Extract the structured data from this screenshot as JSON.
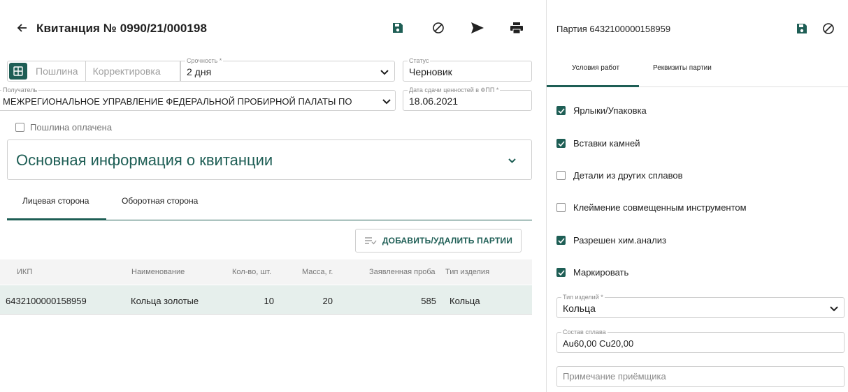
{
  "receipt": {
    "title": "Квитанция № 0990/21/000198",
    "segments": [
      "Пошлина",
      "Корректировка"
    ],
    "urgency": {
      "label": "Срочность *",
      "value": "2 дня"
    },
    "status": {
      "label": "Статус",
      "value": "Черновик"
    },
    "recipient": {
      "label": "Получатель",
      "value": "МЕЖРЕГИОНАЛЬНОЕ УПРАВЛЕНИЕ ФЕДЕРАЛЬНОЙ ПРОБИРНОЙ ПАЛАТЫ ПО"
    },
    "delivery_date": {
      "label": "Дата сдачи ценностей в ФПП *",
      "value": "18.06.2021"
    },
    "duty_paid": {
      "label": "Пошлина оплачена",
      "checked": false
    },
    "accordion_title": "Основная информация о квитанции",
    "tabs": [
      "Лицевая сторона",
      "Оборотная сторона"
    ],
    "add_button": "ДОБАВИТЬ/УДАЛИТЬ ПАРТИИ",
    "table": {
      "headers": [
        "ИКП",
        "Наименование",
        "Кол-во, шт.",
        "Масса, г.",
        "Заявленная проба",
        "Тип изделия"
      ],
      "rows": [
        [
          "6432100000158959",
          "Кольца золотые",
          "10",
          "20",
          "585",
          "Кольца"
        ]
      ]
    }
  },
  "batch": {
    "title": "Партия 6432100000158959",
    "tabs": [
      "Условия работ",
      "Реквизиты партии"
    ],
    "conditions": [
      {
        "label": "Ярлыки/Упаковка",
        "checked": true
      },
      {
        "label": "Вставки камней",
        "checked": true
      },
      {
        "label": "Детали из других сплавов",
        "checked": false
      },
      {
        "label": "Клеймение совмещенным инструментом",
        "checked": false
      },
      {
        "label": "Разрешен хим.анализ",
        "checked": true
      },
      {
        "label": "Маркировать",
        "checked": true
      }
    ],
    "product_type": {
      "label": "Тип изделий *",
      "value": "Кольца"
    },
    "alloy": {
      "label": "Состав сплава",
      "value": "Au60,00 Cu20,00"
    },
    "note": {
      "placeholder": "Примечание приёмщика"
    }
  },
  "colors": {
    "accent": "#1e5e55",
    "row_selected": "#e6efec",
    "border": "#cfcfcf"
  },
  "icons": [
    "back-arrow-icon",
    "save-icon",
    "cancel-icon",
    "send-icon",
    "print-icon",
    "calculator-icon",
    "chevron-down-icon",
    "checkbox-icon",
    "filter-list-icon"
  ]
}
